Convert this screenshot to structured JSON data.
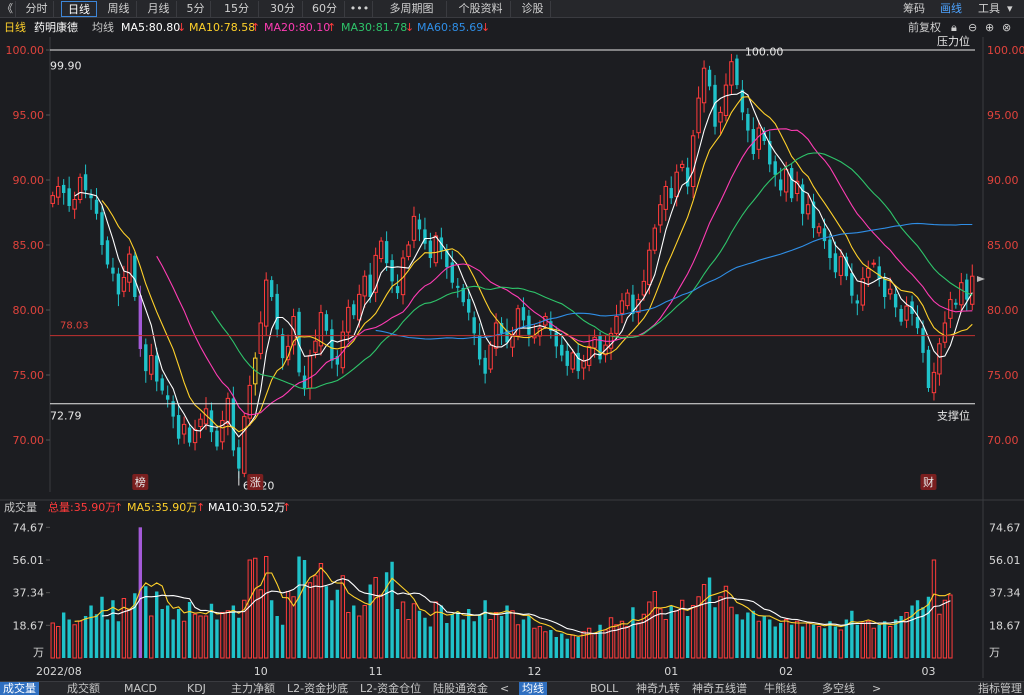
{
  "toolbar": {
    "back": "《",
    "tabs": [
      "分时",
      "日线",
      "周线",
      "月线",
      "5分",
      "15分",
      "30分",
      "60分",
      "•••",
      "多周期图",
      "个股资料",
      "诊股"
    ],
    "active_tab": "日线",
    "right": [
      "筹码",
      "画线",
      "工具"
    ]
  },
  "header": {
    "period": "日线",
    "name": "药明康德",
    "ma_label": "均线",
    "ma5": "MA5:80.80",
    "ma10": "MA10:78.58",
    "ma20": "MA20:80.10",
    "ma30": "MA30:81.78",
    "ma60": "MA60:85.69",
    "arrow_up": "↑",
    "arrow_down": "↓",
    "adjust": "前复权"
  },
  "price_panel": {
    "y_ticks": [
      "100.00",
      "95.00",
      "90.00",
      "85.00",
      "80.00",
      "75.00",
      "70.00"
    ],
    "resistance_label": "压力位",
    "support_label": "支撑位",
    "high_value": "99.90",
    "low_value": "72.79",
    "peak_value": "100.00",
    "bottom_value": "67.20",
    "ref_value": "78.03",
    "markers": [
      "榜",
      "涨",
      "财"
    ]
  },
  "volume_panel": {
    "title": "成交量",
    "total": "总量:35.90万",
    "ma5": "MA5:35.90万",
    "ma10": "MA10:30.52万",
    "y_ticks": [
      "74.67",
      "56.01",
      "37.34",
      "18.67"
    ],
    "unit": "万",
    "x_ticks": [
      "2022/08",
      "10",
      "11",
      "12",
      "01",
      "02",
      "03"
    ]
  },
  "bottom_tabs": [
    "成交量",
    "成交额",
    "MACD",
    "KDJ",
    "主力净额",
    "L2-资金抄底",
    "L2-资金仓位",
    "陆股通资金",
    "均线",
    "BOLL",
    "神奇九转",
    "神奇五线谱",
    "牛熊线",
    "多空线",
    "指标管理"
  ],
  "bottom_nav": [
    "<",
    ">"
  ],
  "colors": {
    "up": "#ff3b3b",
    "down": "#1fc2c9",
    "ma5": "#ffffff",
    "ma10": "#ffd12a",
    "ma20": "#ff3cb4",
    "ma30": "#2ec46a",
    "ma60": "#2f8ee6",
    "bg": "#1c1d21"
  },
  "chart_data": {
    "type": "candlestick",
    "series_closes": [
      88.8,
      89.5,
      89.0,
      88.0,
      88.5,
      90.2,
      89.2,
      88.6,
      87.4,
      85.0,
      83.5,
      82.8,
      81.2,
      82.5,
      84.3,
      81.0,
      77.0,
      75.3,
      76.5,
      74.5,
      73.8,
      73.1,
      71.8,
      70.1,
      71.2,
      69.8,
      70.8,
      71.6,
      72.4,
      70.6,
      69.5,
      71.5,
      73.2,
      69.2,
      67.8,
      71.8,
      74.2,
      76.3,
      79.0,
      82.3,
      81.0,
      78.5,
      76.3,
      77.2,
      79.5,
      75.2,
      74.0,
      76.5,
      77.6,
      79.8,
      78.4,
      76.1,
      75.8,
      78.3,
      80.2,
      79.6,
      81.2,
      82.6,
      81.0,
      84.2,
      85.3,
      83.6,
      82.2,
      81.3,
      84.0,
      85.0,
      87.2,
      86.2,
      85.1,
      84.0,
      85.7,
      84.5,
      83.3,
      82.1,
      81.7,
      80.6,
      79.8,
      78.2,
      76.2,
      75.1,
      77.3,
      79.0,
      78.2,
      77.5,
      78.1,
      80.1,
      79.2,
      78.1,
      78.0,
      78.6,
      79.5,
      78.4,
      77.2,
      76.5,
      75.7,
      76.7,
      75.3,
      76.1,
      77.2,
      77.9,
      76.2,
      77.3,
      78.2,
      79.5,
      80.7,
      81.3,
      79.7,
      80.8,
      82.2,
      84.6,
      86.3,
      88.1,
      89.5,
      88.6,
      90.6,
      91.2,
      89.5,
      93.4,
      96.3,
      98.6,
      97.2,
      94.1,
      95.2,
      97.3,
      99.1,
      97.3,
      95.2,
      93.8,
      92.0,
      94.0,
      93.0,
      91.2,
      90.4,
      89.2,
      90.8,
      88.6,
      89.9,
      87.4,
      88.1,
      86.3,
      86.4,
      85.3,
      84.0,
      82.9,
      84.1,
      82.6,
      81.1,
      80.5,
      82.4,
      83.2,
      83.6,
      82.4,
      81.0,
      81.6,
      80.2,
      79.1,
      80.3,
      79.7,
      78.6,
      76.7,
      74.0,
      75.2,
      77.4,
      79.0,
      80.8,
      80.4,
      82.1,
      80.8,
      82.6
    ],
    "volumes": [
      20,
      18,
      26,
      22,
      19,
      21,
      24,
      30,
      25,
      35,
      22,
      33,
      21,
      34,
      28,
      37,
      74.67,
      41,
      24,
      38,
      28,
      30,
      22,
      28,
      21,
      32,
      25,
      24,
      24,
      31,
      22,
      26,
      27,
      30,
      23,
      33,
      56,
      57,
      39,
      58,
      33,
      24,
      19,
      38,
      35,
      58,
      56,
      43,
      47,
      54,
      41,
      33,
      39,
      47,
      26,
      30,
      24,
      30,
      42,
      46,
      36,
      49,
      55,
      28,
      32,
      22,
      31,
      27,
      23,
      18,
      32,
      30,
      20,
      25,
      26,
      22,
      28,
      21,
      25,
      33,
      22,
      26,
      24,
      30,
      27,
      19,
      22,
      24,
      17,
      18,
      15,
      16,
      12,
      14,
      11,
      13,
      12,
      15,
      17,
      14,
      19,
      16,
      23,
      19,
      21,
      18,
      29,
      20,
      25,
      32,
      38,
      28,
      22,
      30,
      27,
      33,
      24,
      30,
      35,
      42,
      46,
      29,
      35,
      41,
      29,
      25,
      22,
      26,
      27,
      21,
      24,
      22,
      18,
      20,
      22,
      19,
      21,
      18,
      20,
      19,
      18,
      17,
      21,
      18,
      16,
      22,
      27,
      19,
      20,
      21,
      17,
      19,
      21,
      18,
      22,
      24,
      26,
      30,
      33,
      29,
      35,
      56,
      25,
      33,
      36
    ],
    "ylim": [
      66,
      101
    ],
    "volume_ylim": [
      0,
      80
    ],
    "ma_values": {
      "MA5": 80.8,
      "MA10": 78.58,
      "MA20": 80.1,
      "MA30": 81.78,
      "MA60": 85.69
    },
    "resistance": 100.0,
    "support": 72.79,
    "reference": 78.03
  }
}
